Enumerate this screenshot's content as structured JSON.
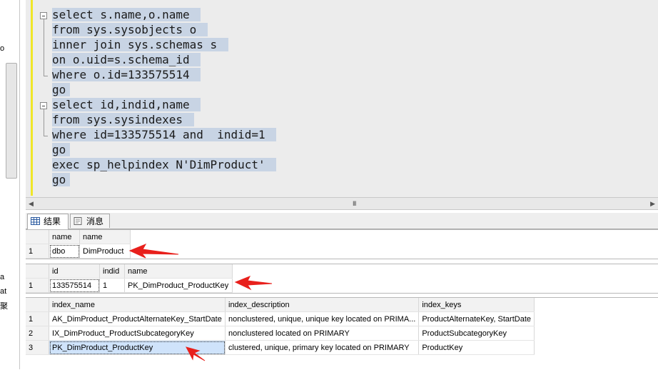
{
  "left_panel": {
    "fragments": [
      "o",
      "a",
      "at",
      "聚"
    ]
  },
  "editor": {
    "lines": [
      "select s.name,o.name ",
      "from sys.sysobjects o ",
      "inner join sys.schemas s ",
      "on o.uid=s.schema_id ",
      "where o.id=133575514 ",
      "go",
      "select id,indid,name ",
      "from sys.sysindexes ",
      "where id=133575514 and  indid=1 ",
      "go",
      "exec sp_helpindex N'DimProduct' ",
      "go"
    ]
  },
  "hscroll": {
    "grip": "III"
  },
  "tabs": [
    {
      "label": "结果",
      "icon": "grid-icon",
      "active": true
    },
    {
      "label": "消息",
      "icon": "message-icon",
      "active": false
    }
  ],
  "result1": {
    "columns": [
      "name",
      "name"
    ],
    "rows": [
      {
        "num": "1",
        "cells": [
          "dbo",
          "DimProduct"
        ]
      }
    ]
  },
  "result2": {
    "columns": [
      "id",
      "indid",
      "name"
    ],
    "rows": [
      {
        "num": "1",
        "cells": [
          "133575514",
          "1",
          "PK_DimProduct_ProductKey"
        ]
      }
    ]
  },
  "result3": {
    "columns": [
      "index_name",
      "index_description",
      "index_keys"
    ],
    "rows": [
      {
        "num": "1",
        "cells": [
          "AK_DimProduct_ProductAlternateKey_StartDate",
          "nonclustered, unique, unique key located on PRIMA...",
          "ProductAlternateKey, StartDate"
        ]
      },
      {
        "num": "2",
        "cells": [
          "IX_DimProduct_ProductSubcategoryKey",
          "nonclustered located on PRIMARY",
          "ProductSubcategoryKey"
        ]
      },
      {
        "num": "3",
        "cells": [
          "PK_DimProduct_ProductKey",
          "clustered, unique, primary key located on PRIMARY",
          "ProductKey"
        ]
      }
    ]
  },
  "colors": {
    "annotation_arrow": "#e8201c",
    "selection": "#cfe3fb",
    "editor_bg": "#ececec",
    "code_highlight": "#c8d4e4"
  }
}
